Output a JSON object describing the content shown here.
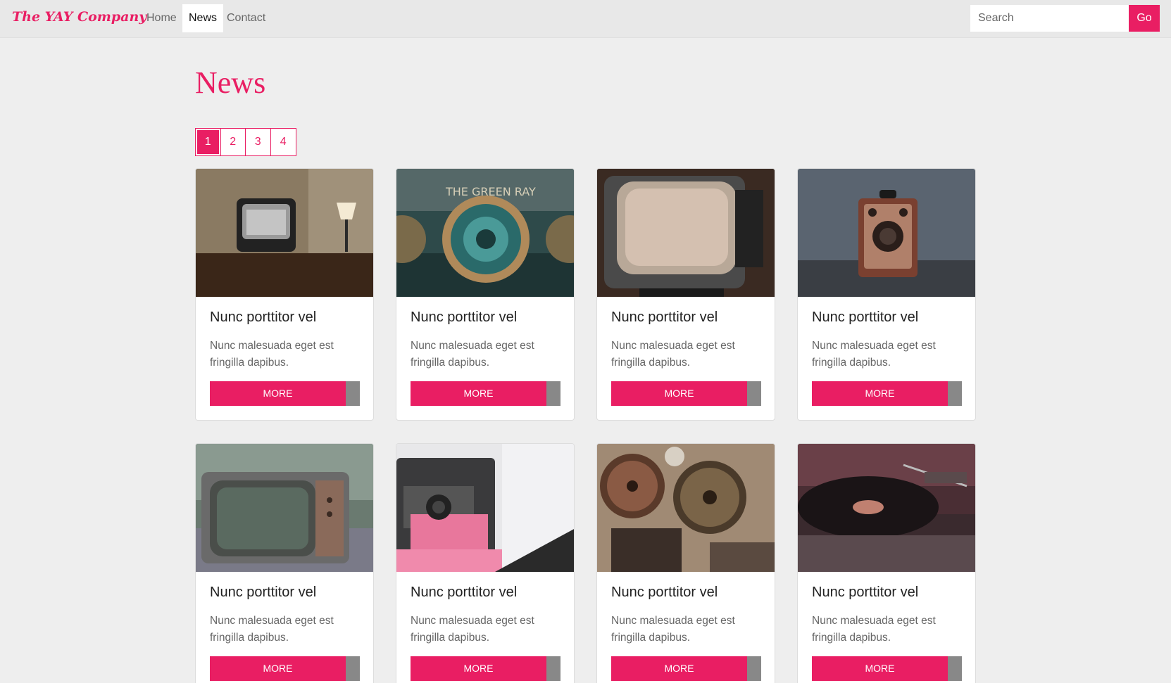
{
  "brand": "The YAY Company",
  "nav": [
    {
      "label": "Home",
      "active": false
    },
    {
      "label": "News",
      "active": true
    },
    {
      "label": "Contact",
      "active": false
    }
  ],
  "search": {
    "placeholder": "Search",
    "button_label": "Go"
  },
  "page_title": "News",
  "pagination": [
    {
      "label": "1",
      "active": true
    },
    {
      "label": "2",
      "active": false
    },
    {
      "label": "3",
      "active": false
    },
    {
      "label": "4",
      "active": false
    }
  ],
  "cards": [
    {
      "image": "vintage-tv-photo",
      "title": "Nunc porttitor vel",
      "text": "Nunc malesuada eget est fringilla dapibus.",
      "button": "MORE"
    },
    {
      "image": "green-ray-camera-photo",
      "title": "Nunc porttitor vel",
      "text": "Nunc malesuada eget est fringilla dapibus.",
      "button": "MORE"
    },
    {
      "image": "retro-tv-screen-photo",
      "title": "Nunc porttitor vel",
      "text": "Nunc malesuada eget est fringilla dapibus.",
      "button": "MORE"
    },
    {
      "image": "brownie-camera-photo",
      "title": "Nunc porttitor vel",
      "text": "Nunc malesuada eget est fringilla dapibus.",
      "button": "MORE"
    },
    {
      "image": "broken-tv-photo",
      "title": "Nunc porttitor vel",
      "text": "Nunc malesuada eget est fringilla dapibus.",
      "button": "MORE"
    },
    {
      "image": "polaroid-camera-photo",
      "title": "Nunc porttitor vel",
      "text": "Nunc malesuada eget est fringilla dapibus.",
      "button": "MORE"
    },
    {
      "image": "film-projector-photo",
      "title": "Nunc porttitor vel",
      "text": "Nunc malesuada eget est fringilla dapibus.",
      "button": "MORE"
    },
    {
      "image": "record-player-photo",
      "title": "Nunc porttitor vel",
      "text": "Nunc malesuada eget est fringilla dapibus.",
      "button": "MORE"
    }
  ],
  "colors": {
    "accent": "#e91e63",
    "button_edge": "#888888",
    "background": "#eeeeee"
  }
}
